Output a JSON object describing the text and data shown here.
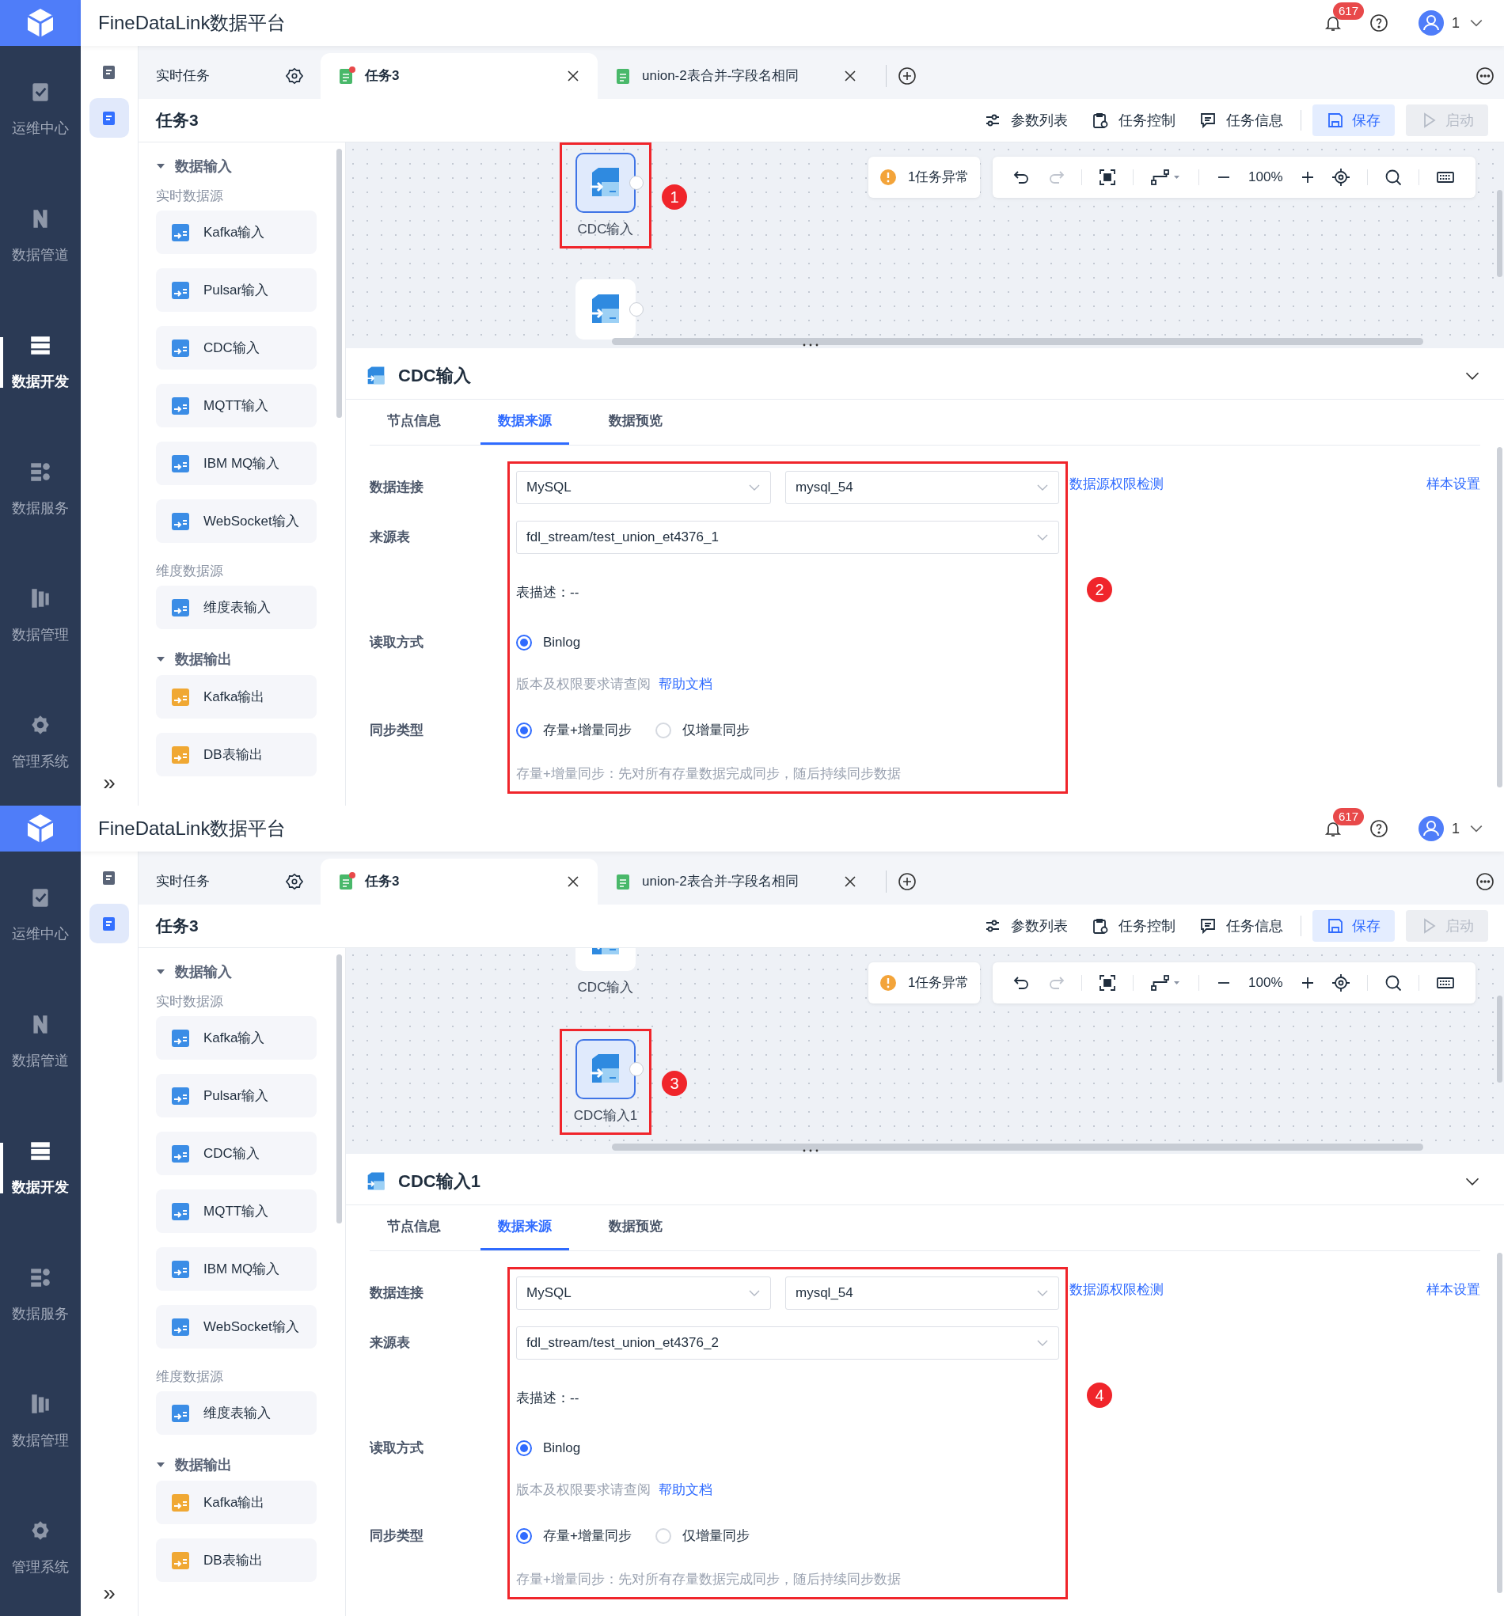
{
  "screens": [
    {
      "app_title": "FineDataLink数据平台",
      "notification_count": "617",
      "user": "1",
      "nav": [
        {
          "label": "运维中心",
          "selected": false
        },
        {
          "label": "数据管道",
          "selected": false
        },
        {
          "label": "数据开发",
          "selected": true
        },
        {
          "label": "数据服务",
          "selected": false
        },
        {
          "label": "数据管理",
          "selected": false
        },
        {
          "label": "管理系统",
          "selected": false
        }
      ],
      "side_tools": [
        {
          "selected": false
        },
        {
          "selected": true
        }
      ],
      "collapse": "»",
      "tabs": [
        {
          "kind": "list",
          "label": "实时任务",
          "selected": false
        },
        {
          "kind": "task",
          "label": "任务3",
          "selected": true,
          "modified": true
        },
        {
          "kind": "task",
          "label": "union-2表合并-字段名相同",
          "selected": false,
          "modified": false
        }
      ],
      "task_title": "任务3",
      "actions": [
        {
          "kind": "params",
          "label": "参数列表",
          "disabled": false
        },
        {
          "kind": "control",
          "label": "任务控制",
          "disabled": false
        },
        {
          "kind": "info",
          "label": "任务信息",
          "disabled": false
        },
        {
          "kind": "save",
          "label": "保存",
          "disabled": false
        },
        {
          "kind": "start",
          "label": "启动",
          "disabled": true
        }
      ],
      "palette": [
        {
          "kind": "group",
          "label": "数据输入",
          "expanded": true
        },
        {
          "kind": "subheading",
          "label": "实时数据源"
        },
        {
          "kind": "item",
          "label": "Kafka输入",
          "color": "#3b8de6"
        },
        {
          "kind": "item",
          "label": "Pulsar输入",
          "color": "#3b8de6"
        },
        {
          "kind": "item",
          "label": "CDC输入",
          "color": "#3b8de6"
        },
        {
          "kind": "item",
          "label": "MQTT输入",
          "color": "#3b8de6"
        },
        {
          "kind": "item",
          "label": "IBM MQ输入",
          "color": "#3b8de6"
        },
        {
          "kind": "item",
          "label": "WebSocket输入",
          "color": "#3b8de6"
        },
        {
          "kind": "subheading",
          "label": "维度数据源"
        },
        {
          "kind": "item",
          "label": "维度表输入",
          "color": "#3b8de6"
        },
        {
          "kind": "group",
          "label": "数据输出",
          "expanded": true
        },
        {
          "kind": "item",
          "label": "Kafka输出",
          "color": "#f0a833"
        },
        {
          "kind": "item",
          "label": "DB表输出",
          "color": "#f0a833"
        }
      ],
      "canvas": {
        "warning": "1任务异常",
        "zoom": "100%",
        "nodes": [
          {
            "label": "CDC输入",
            "selected": true,
            "annotation": "1"
          },
          {
            "selected": false
          }
        ]
      },
      "detail": {
        "title": "CDC输入",
        "tabs": [
          {
            "label": "节点信息",
            "selected": false
          },
          {
            "label": "数据来源",
            "selected": true
          },
          {
            "label": "数据预览",
            "selected": false
          }
        ],
        "annotation": "2",
        "connection": {
          "label": "数据连接",
          "type": "MySQL",
          "name": "mysql_54",
          "check_link": "数据源权限检测",
          "sample_link": "样本设置"
        },
        "source_table": {
          "label": "来源表",
          "value": "fdl_stream/test_union_et4376_1",
          "description": "表描述：--"
        },
        "read_mode": {
          "label": "读取方式",
          "options": [
            {
              "label": "Binlog",
              "selected": true
            }
          ],
          "hint": "版本及权限要求请查阅",
          "help_link": "帮助文档"
        },
        "sync_type": {
          "label": "同步类型",
          "options": [
            {
              "label": "存量+增量同步",
              "selected": true
            },
            {
              "label": "仅增量同步",
              "selected": false
            }
          ],
          "hint": "存量+增量同步：先对所有存量数据完成同步，随后持续同步数据"
        }
      }
    },
    {
      "app_title": "FineDataLink数据平台",
      "notification_count": "617",
      "user": "1",
      "nav": [
        {
          "label": "运维中心",
          "selected": false
        },
        {
          "label": "数据管道",
          "selected": false
        },
        {
          "label": "数据开发",
          "selected": true
        },
        {
          "label": "数据服务",
          "selected": false
        },
        {
          "label": "数据管理",
          "selected": false
        },
        {
          "label": "管理系统",
          "selected": false
        }
      ],
      "side_tools": [
        {
          "selected": false
        },
        {
          "selected": true
        }
      ],
      "collapse": "»",
      "tabs": [
        {
          "kind": "list",
          "label": "实时任务",
          "selected": false
        },
        {
          "kind": "task",
          "label": "任务3",
          "selected": true,
          "modified": true
        },
        {
          "kind": "task",
          "label": "union-2表合并-字段名相同",
          "selected": false,
          "modified": false
        }
      ],
      "task_title": "任务3",
      "actions": [
        {
          "kind": "params",
          "label": "参数列表",
          "disabled": false
        },
        {
          "kind": "control",
          "label": "任务控制",
          "disabled": false
        },
        {
          "kind": "info",
          "label": "任务信息",
          "disabled": false
        },
        {
          "kind": "save",
          "label": "保存",
          "disabled": false
        },
        {
          "kind": "start",
          "label": "启动",
          "disabled": true
        }
      ],
      "palette": [
        {
          "kind": "group",
          "label": "数据输入",
          "expanded": true
        },
        {
          "kind": "subheading",
          "label": "实时数据源"
        },
        {
          "kind": "item",
          "label": "Kafka输入",
          "color": "#3b8de6"
        },
        {
          "kind": "item",
          "label": "Pulsar输入",
          "color": "#3b8de6"
        },
        {
          "kind": "item",
          "label": "CDC输入",
          "color": "#3b8de6"
        },
        {
          "kind": "item",
          "label": "MQTT输入",
          "color": "#3b8de6"
        },
        {
          "kind": "item",
          "label": "IBM MQ输入",
          "color": "#3b8de6"
        },
        {
          "kind": "item",
          "label": "WebSocket输入",
          "color": "#3b8de6"
        },
        {
          "kind": "subheading",
          "label": "维度数据源"
        },
        {
          "kind": "item",
          "label": "维度表输入",
          "color": "#3b8de6"
        },
        {
          "kind": "group",
          "label": "数据输出",
          "expanded": true
        },
        {
          "kind": "item",
          "label": "Kafka输出",
          "color": "#f0a833"
        },
        {
          "kind": "item",
          "label": "DB表输出",
          "color": "#f0a833"
        }
      ],
      "canvas": {
        "warning": "1任务异常",
        "zoom": "100%",
        "nodes": [
          {
            "label": "CDC输入",
            "selected": false
          },
          {
            "label": "CDC输入1",
            "selected": true,
            "annotation": "3"
          }
        ]
      },
      "detail": {
        "title": "CDC输入1",
        "tabs": [
          {
            "label": "节点信息",
            "selected": false
          },
          {
            "label": "数据来源",
            "selected": true
          },
          {
            "label": "数据预览",
            "selected": false
          }
        ],
        "annotation": "4",
        "connection": {
          "label": "数据连接",
          "type": "MySQL",
          "name": "mysql_54",
          "check_link": "数据源权限检测",
          "sample_link": "样本设置"
        },
        "source_table": {
          "label": "来源表",
          "value": "fdl_stream/test_union_et4376_2",
          "description": "表描述：--"
        },
        "read_mode": {
          "label": "读取方式",
          "options": [
            {
              "label": "Binlog",
              "selected": true
            }
          ],
          "hint": "版本及权限要求请查阅",
          "help_link": "帮助文档"
        },
        "sync_type": {
          "label": "同步类型",
          "options": [
            {
              "label": "存量+增量同步",
              "selected": true
            },
            {
              "label": "仅增量同步",
              "selected": false
            }
          ],
          "hint": "存量+增量同步：先对所有存量数据完成同步，随后持续同步数据"
        }
      }
    }
  ]
}
